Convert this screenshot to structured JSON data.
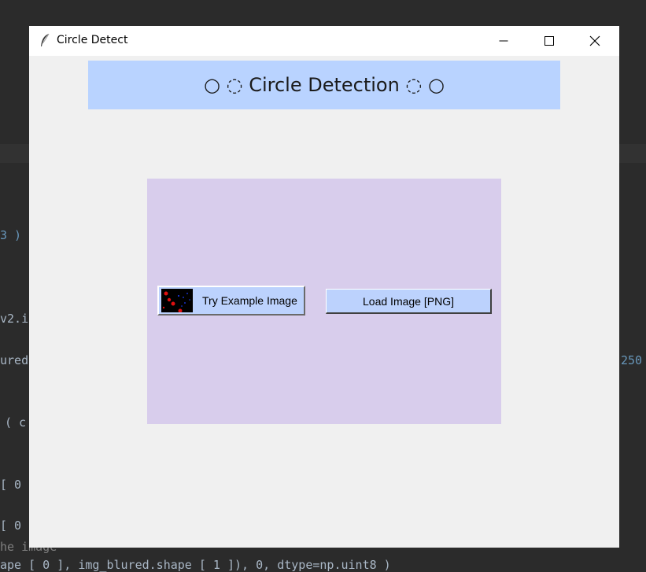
{
  "window": {
    "title": "Circle Detect",
    "controls": {
      "minimize": "minimize-icon",
      "maximize": "maximize-icon",
      "close": "close-icon"
    }
  },
  "header": {
    "title": "○ ◌ Circle Detection ◌ ○",
    "background": "#b9d3ff"
  },
  "panel": {
    "background": "#d8cdec",
    "example_button_label": "Try Example Image",
    "load_button_label": "Load Image [PNG]",
    "button_background": "#bcd2fd"
  },
  "background_code": {
    "lines": [
      "3 )",
      "v2.i",
      "ured",
      "250",
      "( c",
      "[ 0",
      "[ 0",
      "he image",
      "ape [ 0 ], img_blured.shape [ 1 ]), 0, dtype=np.uint8 )"
    ]
  }
}
